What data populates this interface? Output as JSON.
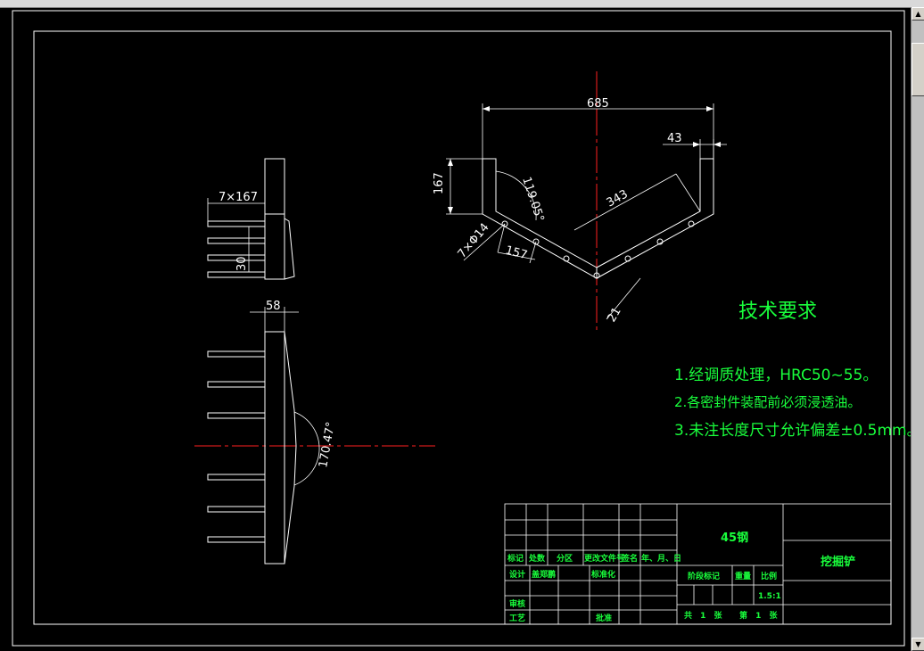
{
  "app": {
    "background": "#000000",
    "line_color": "#ffffff",
    "text_color": "#19ff3c",
    "centerline_color": "#ff2020"
  },
  "top_view": {
    "dim_width": "685",
    "dim_tip": "43",
    "dim_length": "343",
    "dim_height": "167",
    "dim_angle": "119.05°",
    "dim_holes": "7×Φ14",
    "dim_spacing": "157",
    "dim_thickness": "21"
  },
  "side_view": {
    "dim_pitch": "7×167",
    "dim_tooth": "30"
  },
  "front_view": {
    "dim_depth": "58",
    "dim_angle": "170.47°"
  },
  "tech_req": {
    "title": "技术要求",
    "items": [
      "1.经调质处理，HRC50~55。",
      "2.各密封件装配前必须浸透油。",
      "3.未注长度尺寸允许偏差±0.5mm。"
    ]
  },
  "title_block": {
    "material": "45钢",
    "part_name": "挖掘铲",
    "row_labels": [
      "标记",
      "处数",
      "分区",
      "更改文件号",
      "签名",
      "年、月、日"
    ],
    "design": "设计",
    "designer": "盖郑鹏",
    "standardize": "标准化",
    "stage_mark": "阶段标记",
    "weight": "重量",
    "scale": "比例",
    "scale_value": "1.5:1",
    "review": "审核",
    "process": "工艺",
    "approve": "批准",
    "sheets_total": "共 1 张",
    "sheet_no": "第 1 张"
  }
}
